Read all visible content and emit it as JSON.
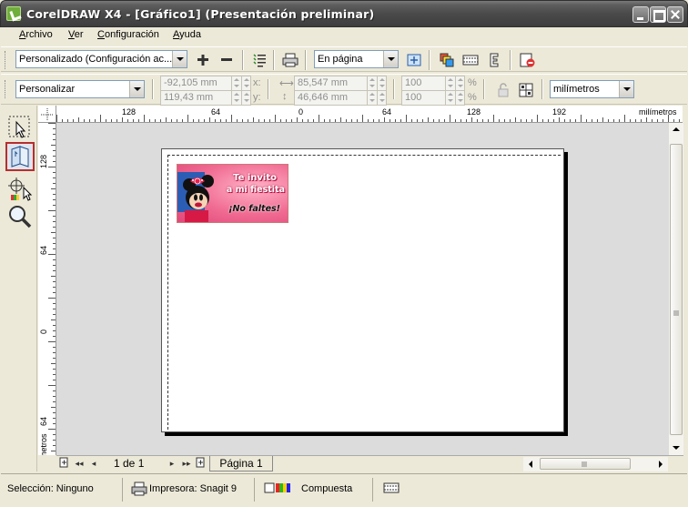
{
  "window": {
    "title": "CorelDRAW X4 - [Gráfico1] (Presentación preliminar)"
  },
  "menu": {
    "items": [
      "Archivo",
      "Ver",
      "Configuración",
      "Ayuda"
    ]
  },
  "toolbar1": {
    "preset_combo": "Personalizado (Configuración ac...",
    "add_icon": "plus-icon",
    "remove_icon": "minus-icon",
    "fit_combo": "En página"
  },
  "toolbar2": {
    "layout_combo": "Personalizar",
    "pos_x": "-92,105 mm",
    "pos_y": "119,43 mm",
    "label_x": "x:",
    "label_y": "y:",
    "width": "85,547 mm",
    "height": "46,646 mm",
    "scale_x": "100",
    "scale_y": "100",
    "percent": "%",
    "units_combo": "milímetros"
  },
  "ruler_h": {
    "labels": [
      "128",
      "64",
      "0",
      "64",
      "128",
      "192"
    ],
    "units": "milímetros"
  },
  "ruler_v": {
    "labels": [
      "128",
      "64",
      "0",
      "64"
    ],
    "units": "milímetros"
  },
  "preview": {
    "card_line1": "Te invito",
    "card_line2": "a mi fiestita",
    "card_line3": "¡No faltes!"
  },
  "pagebar": {
    "page_counter": "1 de 1",
    "page_tab": "Página 1"
  },
  "status": {
    "selection": "Selección: Ninguno",
    "printer": "Impresora: Snagit 9",
    "color_mode": "Compuesta"
  },
  "colors": {
    "title_bar": "#4a4a4a",
    "active_tool_border": "#b72e2e",
    "card_pink": "#f06b92"
  }
}
